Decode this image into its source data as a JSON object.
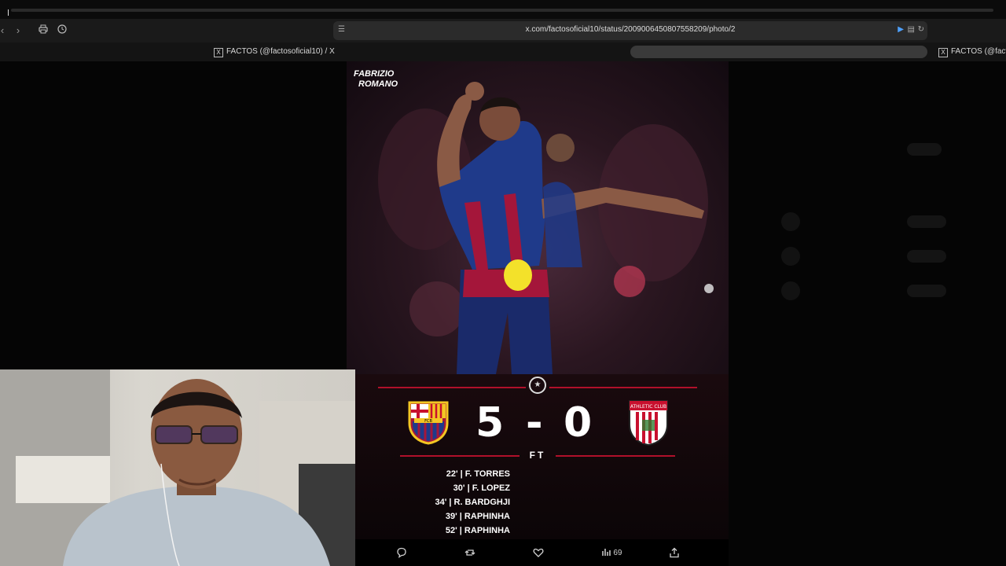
{
  "browser": {
    "url": "x.com/factosoficial10/status/2009006450807558209/photo/2",
    "tabs": [
      {
        "label": "FACTOS (@factosoficial10) / X"
      },
      {
        "label": "FACTOS (@factos"
      }
    ]
  },
  "photo": {
    "brand_line1": "FABRIZIO",
    "brand_line2": "ROMANO"
  },
  "scorecard": {
    "home_score": "5",
    "dash": "-",
    "away_score": "0",
    "status": "FT",
    "away_crest_text": "ATHLETIC CLUB",
    "home_crest_text": "FCB",
    "scorers": [
      "22' | F. TORRES",
      "30' | F. LOPEZ",
      "34' | R. BARDGHJI",
      "39' | RAPHINHA",
      "52' | RAPHINHA"
    ]
  },
  "actions": {
    "views": "69"
  },
  "colors": {
    "barca_blue": "#1f3a8a",
    "barca_red": "#a4163a",
    "accent_red": "#b0102a"
  }
}
